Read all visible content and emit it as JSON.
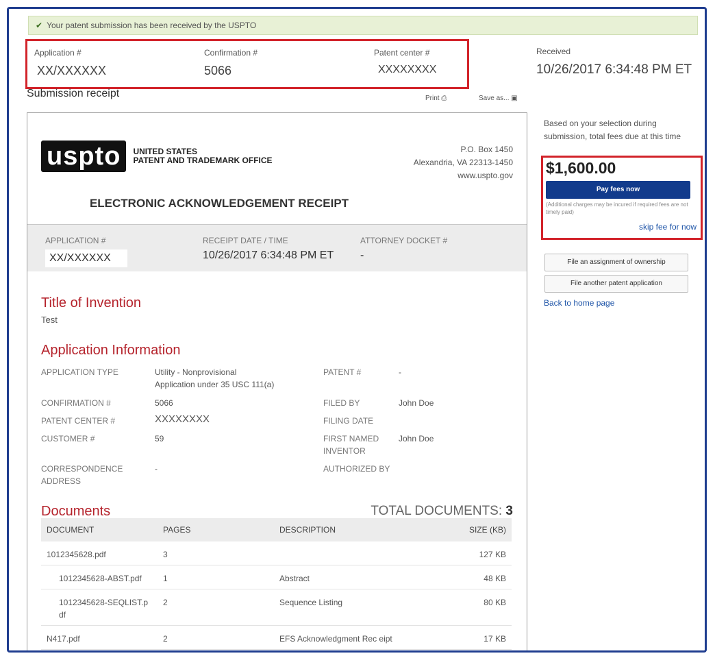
{
  "banner": {
    "text": "Your patent submission has been received by the USPTO"
  },
  "ids": {
    "application_label": "Application #",
    "application_value": "XX/XXXXXX",
    "confirmation_label": "Confirmation #",
    "confirmation_value": "5066",
    "patent_center_label": "Patent center #",
    "patent_center_value": "XXXXXXXX",
    "received_label": "Received",
    "received_value": "10/26/2017 6:34:48 PM ET"
  },
  "receipt_header": {
    "title": "Submission receipt",
    "print": "Print",
    "save_as": "Save as..."
  },
  "receipt": {
    "logo_mark": "uspto",
    "logo_line1": "UNITED STATES",
    "logo_line2": "PATENT AND TRADEMARK OFFICE",
    "address_line1": "P.O. Box 1450",
    "address_line2": "Alexandria, VA 22313-1450",
    "address_line3": "www.uspto.gov",
    "heading": "ELECTRONIC ACKNOWLEDGEMENT RECEIPT",
    "band": {
      "app_label": "APPLICATION #",
      "app_value": "XX/XXXXXX",
      "date_label": "RECEIPT DATE / TIME",
      "date_value": "10/26/2017 6:34:48 PM ET",
      "docket_label": "ATTORNEY DOCKET #",
      "docket_value": "-"
    },
    "title_heading": "Title of Invention",
    "title_value": "Test",
    "app_info_heading": "Application Information",
    "info": {
      "app_type_label": "APPLICATION TYPE",
      "app_type_value_1": "Utility - Nonprovisional",
      "app_type_value_2": "Application under 35 USC 111(a)",
      "patent_label": "PATENT #",
      "patent_value": "-",
      "confirmation_label": "CONFIRMATION #",
      "confirmation_value": "5066",
      "filed_by_label": "FILED BY",
      "filed_by_value": "John Doe",
      "patent_center_label": "PATENT CENTER #",
      "patent_center_value": "XXXXXXXX",
      "filing_date_label": "FILING DATE",
      "customer_label": "CUSTOMER #",
      "customer_value": "59",
      "inventor_label_1": "FIRST NAMED",
      "inventor_label_2": "INVENTOR",
      "inventor_value": "John Doe",
      "corr_label_1": "CORRESPONDENCE",
      "corr_label_2": "ADDRESS",
      "corr_value": "-",
      "authorized_label": "AUTHORIZED BY"
    },
    "documents_heading": "Documents",
    "total_docs_label": "TOTAL DOCUMENTS:",
    "total_docs_value": "3",
    "table": {
      "headers": [
        "DOCUMENT",
        "PAGES",
        "DESCRIPTION",
        "SIZE (KB)"
      ],
      "rows": [
        {
          "doc": "1012345628.pdf",
          "pages": "3",
          "desc": "",
          "size": "127 KB"
        },
        {
          "doc": "1012345628-ABST.pdf",
          "pages": "1",
          "desc": "Abstract",
          "size": "48 KB"
        },
        {
          "doc": "1012345628-SEQLIST.p df",
          "pages": "2",
          "desc": "Sequence Listing",
          "size": "80 KB"
        },
        {
          "doc": "N417.pdf",
          "pages": "2",
          "desc": "EFS Acknowledgment Rec eipt",
          "size": "17 KB"
        }
      ]
    }
  },
  "sidebar": {
    "fees_text": "Based on your selection during submission, total fees due at this time",
    "fee_amount": "$1,600.00",
    "pay_button": "Pay fees now",
    "fee_note": "(Additional charges may be incured if required fees are not timely paid)",
    "skip_link": "skip fee for now",
    "assign_button": "File an assignment of ownership",
    "another_button": "File another patent application",
    "home_link": "Back to home page"
  },
  "colors": {
    "accent_red": "#b5232c",
    "highlight_border": "#d2232a",
    "button_blue": "#123b8c",
    "frame_blue": "#1f3d8f"
  }
}
